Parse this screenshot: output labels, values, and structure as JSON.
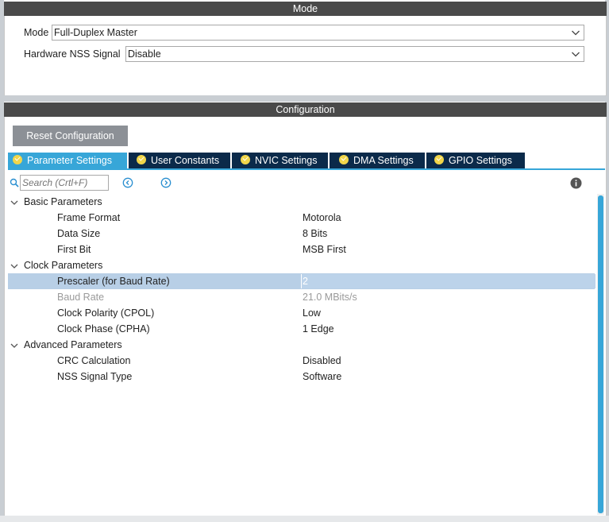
{
  "mode_panel": {
    "title": "Mode",
    "mode_label": "Mode",
    "mode_value": "Full-Duplex Master",
    "nss_label": "Hardware NSS Signal",
    "nss_value": "Disable"
  },
  "config_panel": {
    "title": "Configuration",
    "reset_button": "Reset Configuration",
    "tabs": [
      {
        "label": "Parameter Settings",
        "active": true
      },
      {
        "label": "User Constants",
        "active": false
      },
      {
        "label": "NVIC Settings",
        "active": false
      },
      {
        "label": "DMA Settings",
        "active": false
      },
      {
        "label": "GPIO Settings",
        "active": false
      }
    ],
    "search_placeholder": "Search (Crtl+F)",
    "groups": [
      {
        "label": "Basic Parameters",
        "params": [
          {
            "name": "Frame Format",
            "value": "Motorola"
          },
          {
            "name": "Data Size",
            "value": "8 Bits"
          },
          {
            "name": "First Bit",
            "value": "MSB First"
          }
        ]
      },
      {
        "label": "Clock Parameters",
        "params": [
          {
            "name": "Prescaler (for Baud Rate)",
            "value": "2"
          },
          {
            "name": "Baud Rate",
            "value": "21.0 MBits/s"
          },
          {
            "name": "Clock Polarity (CPOL)",
            "value": "Low"
          },
          {
            "name": "Clock Phase (CPHA)",
            "value": "1 Edge"
          }
        ]
      },
      {
        "label": "Advanced Parameters",
        "params": [
          {
            "name": "CRC Calculation",
            "value": "Disabled"
          },
          {
            "name": "NSS Signal Type",
            "value": "Software"
          }
        ]
      }
    ]
  },
  "colors": {
    "header_bg": "#4a4a4a",
    "tab_active": "#37a6d8",
    "tab_inactive": "#0b2a4a",
    "check_badge": "#f1d64a",
    "selected_row": "#b8cfe6",
    "reset_button_bg": "#8c9096"
  },
  "icons": [
    "chevron-down-icon",
    "search-icon",
    "arrow-left-circle-icon",
    "arrow-right-circle-icon",
    "info-icon",
    "check-circle-icon",
    "expand-toggle-icon"
  ]
}
